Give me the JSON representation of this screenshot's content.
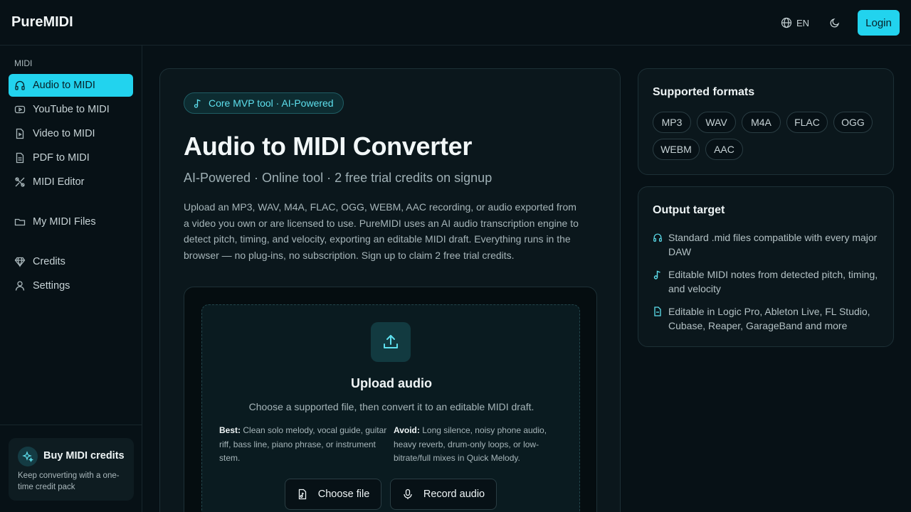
{
  "app": {
    "brand": "PureMIDI"
  },
  "header": {
    "lang_label": "EN",
    "login_label": "Login"
  },
  "sidebar": {
    "section_label": "MIDI",
    "items": [
      {
        "label": "Audio to MIDI",
        "icon": "headphones-icon",
        "active": true
      },
      {
        "label": "YouTube to MIDI",
        "icon": "youtube-icon"
      },
      {
        "label": "Video to MIDI",
        "icon": "video-file-icon"
      },
      {
        "label": "PDF to MIDI",
        "icon": "pdf-file-icon"
      },
      {
        "label": "MIDI Editor",
        "icon": "tools-icon"
      },
      {
        "label": "My MIDI Files",
        "icon": "folder-icon"
      },
      {
        "label": "Credits",
        "icon": "gem-icon"
      },
      {
        "label": "Settings",
        "icon": "user-icon"
      }
    ],
    "credits_box": {
      "title": "Buy MIDI credits",
      "subtitle": "Keep converting with a one-time credit pack"
    }
  },
  "main": {
    "badge": "Core MVP tool · AI-Powered",
    "title": "Audio to MIDI Converter",
    "subtitle": "AI-Powered · Online tool · 2 free trial credits on signup",
    "description": "Upload an MP3, WAV, M4A, FLAC, OGG, WEBM, AAC recording, or audio exported from a video you own or are licensed to use. PureMIDI uses an AI audio transcription engine to detect pitch, timing, and velocity, exporting an editable MIDI draft. Everything runs in the browser — no plug-ins, no subscription. Sign up to claim 2 free trial credits.",
    "upload": {
      "title": "Upload audio",
      "subtitle": "Choose a supported file, then convert it to an editable MIDI draft.",
      "best_label": "Best:",
      "best_text": "Clean solo melody, vocal guide, guitar riff, bass line, piano phrase, or instrument stem.",
      "avoid_label": "Avoid:",
      "avoid_text": "Long silence, noisy phone audio, heavy reverb, drum-only loops, or low-bitrate/full mixes in Quick Melody.",
      "choose_label": "Choose file",
      "record_label": "Record audio"
    }
  },
  "formats": {
    "title": "Supported formats",
    "items": [
      "MP3",
      "WAV",
      "M4A",
      "FLAC",
      "OGG",
      "WEBM",
      "AAC"
    ]
  },
  "output": {
    "title": "Output target",
    "items": [
      "Standard .mid files compatible with every major DAW",
      "Editable MIDI notes from detected pitch, timing, and velocity",
      "Editable in Logic Pro, Ableton Live, FL Studio, Cubase, Reaper, GarageBand and more"
    ]
  },
  "colors": {
    "accent": "#22d3ee",
    "background": "#071116",
    "card": "#0b171c"
  }
}
